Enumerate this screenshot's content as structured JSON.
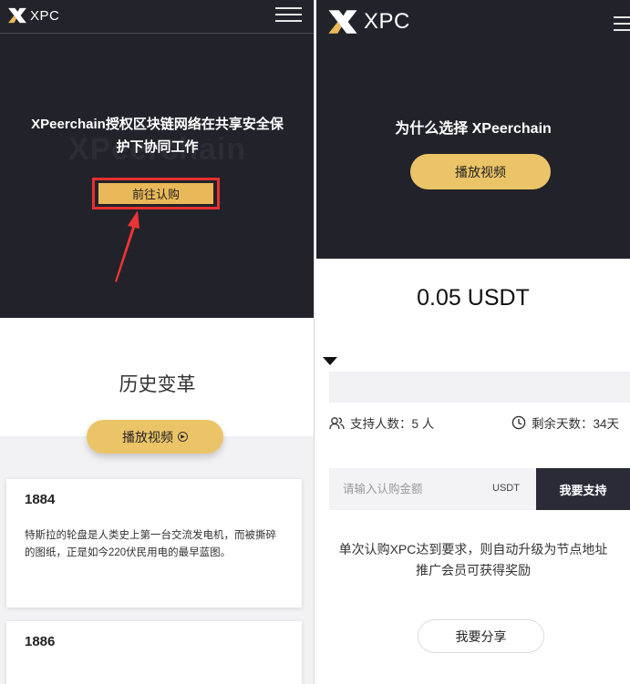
{
  "left": {
    "logo_text": "XPC",
    "hero": {
      "title_line1": "XPeerchain授权区块链网络在共享安全保",
      "title_line2": "护下协同工作",
      "watermark": "XPeerchain",
      "cta_label": "前往认购"
    },
    "history": {
      "title": "历史变革",
      "video_label": "播放视频"
    },
    "timeline": [
      {
        "year": "1884",
        "text": "特斯拉的轮盘是人类史上第一台交流发电机，而被撕碎的图纸，正是如今220伏民用电的最早蓝图。"
      },
      {
        "year": "1886",
        "text": ""
      }
    ]
  },
  "right": {
    "logo_text": "XPC",
    "title": "为什么选择 XPeerchain",
    "video_label": "播放视频",
    "price": "0.05 USDT",
    "progress": 0,
    "supporters": "支持人数：5 人",
    "days_left": "剩余天数：34天",
    "input_placeholder": "请输入认购金额",
    "input_unit": "USDT",
    "support_button": "我要支持",
    "notice_line1": "单次认购XPC达到要求，则自动升级为节点地址",
    "notice_line2": "推广会员可获得奖励",
    "share_button": "我要分享"
  },
  "colors": {
    "dark_bg": "#22222a",
    "accent_gold": "#e9b959",
    "highlight_red": "#e83030",
    "arrow_red": "#e83535"
  },
  "icons": {
    "logo": "xpc-x-logo-icon",
    "menu": "hamburger-menu-icon",
    "play": "play-circle-icon",
    "arrow": "red-arrow-icon",
    "dropdown": "triangle-down-icon",
    "users": "users-icon",
    "clock": "clock-icon"
  }
}
